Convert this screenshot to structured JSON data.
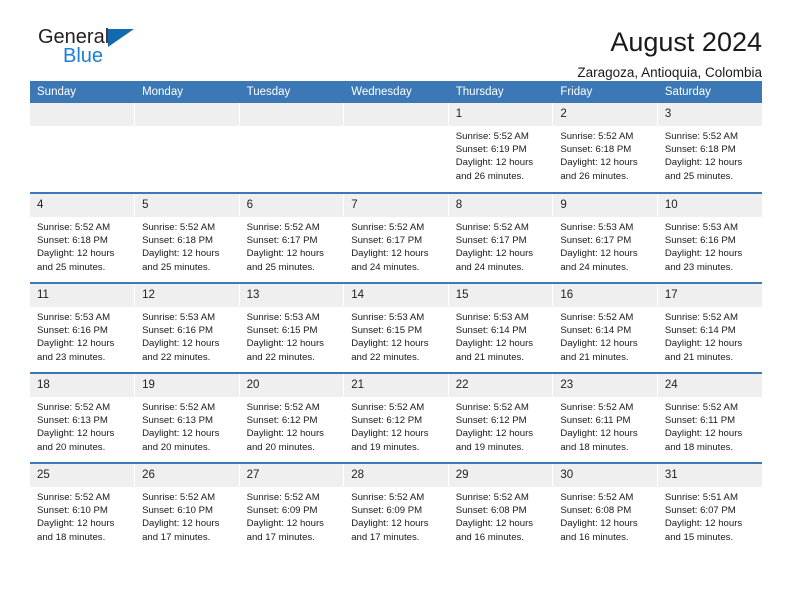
{
  "brand": {
    "name_top": "General",
    "name_bottom": "Blue",
    "triangle_color": "#1269b0",
    "blue_color": "#1b7fd4"
  },
  "header": {
    "title": "August 2024",
    "subtitle": "Zaragoza, Antioquia, Colombia"
  },
  "theme": {
    "header_bg": "#3b78b5",
    "header_text": "#ffffff",
    "daynum_bg": "#efefef",
    "cell_bg": "#ffffff",
    "row_divider": "#3b78b5"
  },
  "columns": [
    "Sunday",
    "Monday",
    "Tuesday",
    "Wednesday",
    "Thursday",
    "Friday",
    "Saturday"
  ],
  "labels": {
    "sunrise": "Sunrise:",
    "sunset": "Sunset:",
    "daylight": "Daylight:"
  },
  "weeks": [
    [
      {
        "day": "",
        "sunrise": "",
        "sunset": "",
        "daylight_1": "",
        "daylight_2": ""
      },
      {
        "day": "",
        "sunrise": "",
        "sunset": "",
        "daylight_1": "",
        "daylight_2": ""
      },
      {
        "day": "",
        "sunrise": "",
        "sunset": "",
        "daylight_1": "",
        "daylight_2": ""
      },
      {
        "day": "",
        "sunrise": "",
        "sunset": "",
        "daylight_1": "",
        "daylight_2": ""
      },
      {
        "day": "1",
        "sunrise": "Sunrise: 5:52 AM",
        "sunset": "Sunset: 6:19 PM",
        "daylight_1": "Daylight: 12 hours",
        "daylight_2": "and 26 minutes."
      },
      {
        "day": "2",
        "sunrise": "Sunrise: 5:52 AM",
        "sunset": "Sunset: 6:18 PM",
        "daylight_1": "Daylight: 12 hours",
        "daylight_2": "and 26 minutes."
      },
      {
        "day": "3",
        "sunrise": "Sunrise: 5:52 AM",
        "sunset": "Sunset: 6:18 PM",
        "daylight_1": "Daylight: 12 hours",
        "daylight_2": "and 25 minutes."
      }
    ],
    [
      {
        "day": "4",
        "sunrise": "Sunrise: 5:52 AM",
        "sunset": "Sunset: 6:18 PM",
        "daylight_1": "Daylight: 12 hours",
        "daylight_2": "and 25 minutes."
      },
      {
        "day": "5",
        "sunrise": "Sunrise: 5:52 AM",
        "sunset": "Sunset: 6:18 PM",
        "daylight_1": "Daylight: 12 hours",
        "daylight_2": "and 25 minutes."
      },
      {
        "day": "6",
        "sunrise": "Sunrise: 5:52 AM",
        "sunset": "Sunset: 6:17 PM",
        "daylight_1": "Daylight: 12 hours",
        "daylight_2": "and 25 minutes."
      },
      {
        "day": "7",
        "sunrise": "Sunrise: 5:52 AM",
        "sunset": "Sunset: 6:17 PM",
        "daylight_1": "Daylight: 12 hours",
        "daylight_2": "and 24 minutes."
      },
      {
        "day": "8",
        "sunrise": "Sunrise: 5:52 AM",
        "sunset": "Sunset: 6:17 PM",
        "daylight_1": "Daylight: 12 hours",
        "daylight_2": "and 24 minutes."
      },
      {
        "day": "9",
        "sunrise": "Sunrise: 5:53 AM",
        "sunset": "Sunset: 6:17 PM",
        "daylight_1": "Daylight: 12 hours",
        "daylight_2": "and 24 minutes."
      },
      {
        "day": "10",
        "sunrise": "Sunrise: 5:53 AM",
        "sunset": "Sunset: 6:16 PM",
        "daylight_1": "Daylight: 12 hours",
        "daylight_2": "and 23 minutes."
      }
    ],
    [
      {
        "day": "11",
        "sunrise": "Sunrise: 5:53 AM",
        "sunset": "Sunset: 6:16 PM",
        "daylight_1": "Daylight: 12 hours",
        "daylight_2": "and 23 minutes."
      },
      {
        "day": "12",
        "sunrise": "Sunrise: 5:53 AM",
        "sunset": "Sunset: 6:16 PM",
        "daylight_1": "Daylight: 12 hours",
        "daylight_2": "and 22 minutes."
      },
      {
        "day": "13",
        "sunrise": "Sunrise: 5:53 AM",
        "sunset": "Sunset: 6:15 PM",
        "daylight_1": "Daylight: 12 hours",
        "daylight_2": "and 22 minutes."
      },
      {
        "day": "14",
        "sunrise": "Sunrise: 5:53 AM",
        "sunset": "Sunset: 6:15 PM",
        "daylight_1": "Daylight: 12 hours",
        "daylight_2": "and 22 minutes."
      },
      {
        "day": "15",
        "sunrise": "Sunrise: 5:53 AM",
        "sunset": "Sunset: 6:14 PM",
        "daylight_1": "Daylight: 12 hours",
        "daylight_2": "and 21 minutes."
      },
      {
        "day": "16",
        "sunrise": "Sunrise: 5:52 AM",
        "sunset": "Sunset: 6:14 PM",
        "daylight_1": "Daylight: 12 hours",
        "daylight_2": "and 21 minutes."
      },
      {
        "day": "17",
        "sunrise": "Sunrise: 5:52 AM",
        "sunset": "Sunset: 6:14 PM",
        "daylight_1": "Daylight: 12 hours",
        "daylight_2": "and 21 minutes."
      }
    ],
    [
      {
        "day": "18",
        "sunrise": "Sunrise: 5:52 AM",
        "sunset": "Sunset: 6:13 PM",
        "daylight_1": "Daylight: 12 hours",
        "daylight_2": "and 20 minutes."
      },
      {
        "day": "19",
        "sunrise": "Sunrise: 5:52 AM",
        "sunset": "Sunset: 6:13 PM",
        "daylight_1": "Daylight: 12 hours",
        "daylight_2": "and 20 minutes."
      },
      {
        "day": "20",
        "sunrise": "Sunrise: 5:52 AM",
        "sunset": "Sunset: 6:12 PM",
        "daylight_1": "Daylight: 12 hours",
        "daylight_2": "and 20 minutes."
      },
      {
        "day": "21",
        "sunrise": "Sunrise: 5:52 AM",
        "sunset": "Sunset: 6:12 PM",
        "daylight_1": "Daylight: 12 hours",
        "daylight_2": "and 19 minutes."
      },
      {
        "day": "22",
        "sunrise": "Sunrise: 5:52 AM",
        "sunset": "Sunset: 6:12 PM",
        "daylight_1": "Daylight: 12 hours",
        "daylight_2": "and 19 minutes."
      },
      {
        "day": "23",
        "sunrise": "Sunrise: 5:52 AM",
        "sunset": "Sunset: 6:11 PM",
        "daylight_1": "Daylight: 12 hours",
        "daylight_2": "and 18 minutes."
      },
      {
        "day": "24",
        "sunrise": "Sunrise: 5:52 AM",
        "sunset": "Sunset: 6:11 PM",
        "daylight_1": "Daylight: 12 hours",
        "daylight_2": "and 18 minutes."
      }
    ],
    [
      {
        "day": "25",
        "sunrise": "Sunrise: 5:52 AM",
        "sunset": "Sunset: 6:10 PM",
        "daylight_1": "Daylight: 12 hours",
        "daylight_2": "and 18 minutes."
      },
      {
        "day": "26",
        "sunrise": "Sunrise: 5:52 AM",
        "sunset": "Sunset: 6:10 PM",
        "daylight_1": "Daylight: 12 hours",
        "daylight_2": "and 17 minutes."
      },
      {
        "day": "27",
        "sunrise": "Sunrise: 5:52 AM",
        "sunset": "Sunset: 6:09 PM",
        "daylight_1": "Daylight: 12 hours",
        "daylight_2": "and 17 minutes."
      },
      {
        "day": "28",
        "sunrise": "Sunrise: 5:52 AM",
        "sunset": "Sunset: 6:09 PM",
        "daylight_1": "Daylight: 12 hours",
        "daylight_2": "and 17 minutes."
      },
      {
        "day": "29",
        "sunrise": "Sunrise: 5:52 AM",
        "sunset": "Sunset: 6:08 PM",
        "daylight_1": "Daylight: 12 hours",
        "daylight_2": "and 16 minutes."
      },
      {
        "day": "30",
        "sunrise": "Sunrise: 5:52 AM",
        "sunset": "Sunset: 6:08 PM",
        "daylight_1": "Daylight: 12 hours",
        "daylight_2": "and 16 minutes."
      },
      {
        "day": "31",
        "sunrise": "Sunrise: 5:51 AM",
        "sunset": "Sunset: 6:07 PM",
        "daylight_1": "Daylight: 12 hours",
        "daylight_2": "and 15 minutes."
      }
    ]
  ]
}
